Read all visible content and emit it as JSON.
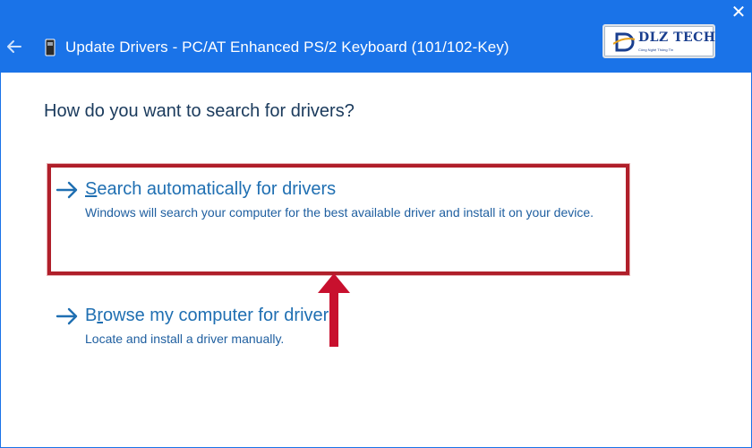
{
  "window": {
    "title": "Update Drivers - PC/AT Enhanced PS/2 Keyboard (101/102-Key)",
    "close_glyph": "✕",
    "back_icon": "back-arrow-icon",
    "device_icon": "keyboard-device-icon"
  },
  "logo": {
    "name": "DLZ TECH",
    "tagline": "Công Nghệ Thông Tin"
  },
  "question": "How do you want to search for drivers?",
  "options": [
    {
      "title_first_letter": "S",
      "title_rest": "earch automatically for drivers",
      "description": "Windows will search your computer for the best available driver and install it on your device.",
      "icon": "right-arrow-icon"
    },
    {
      "title_first_letter": "r",
      "title_prefix": "B",
      "title_rest": "owse my computer for drivers",
      "description": "Locate and install a driver manually.",
      "icon": "right-arrow-icon"
    }
  ],
  "colors": {
    "titlebar": "#1a73e8",
    "link": "#1f6fb2",
    "highlight": "#b01f2a"
  }
}
